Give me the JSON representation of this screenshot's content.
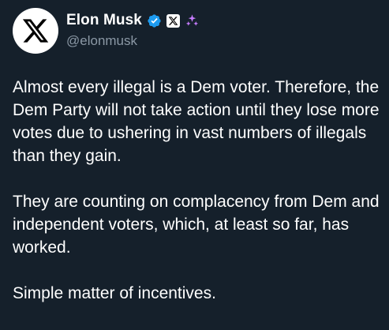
{
  "author": {
    "display_name": "Elon Musk",
    "handle": "@elonmusk",
    "avatar_icon": "x-logo-icon",
    "badges": [
      "verified-icon",
      "x-affiliate-icon",
      "sparkle-icon"
    ]
  },
  "tweet": {
    "paragraphs": [
      "Almost every illegal is a Dem voter. Therefore, the Dem Party will not take action until they lose more votes due to ushering in vast numbers of illegals than they gain.",
      "They are counting on complacency from Dem and independent voters, which, at least so far, has worked.",
      "Simple matter of incentives."
    ]
  },
  "colors": {
    "background": "#15202b",
    "text": "#ffffff",
    "secondary_text": "#8b98a5",
    "verified": "#1d9bf0",
    "sparkle": "#c77dff"
  }
}
